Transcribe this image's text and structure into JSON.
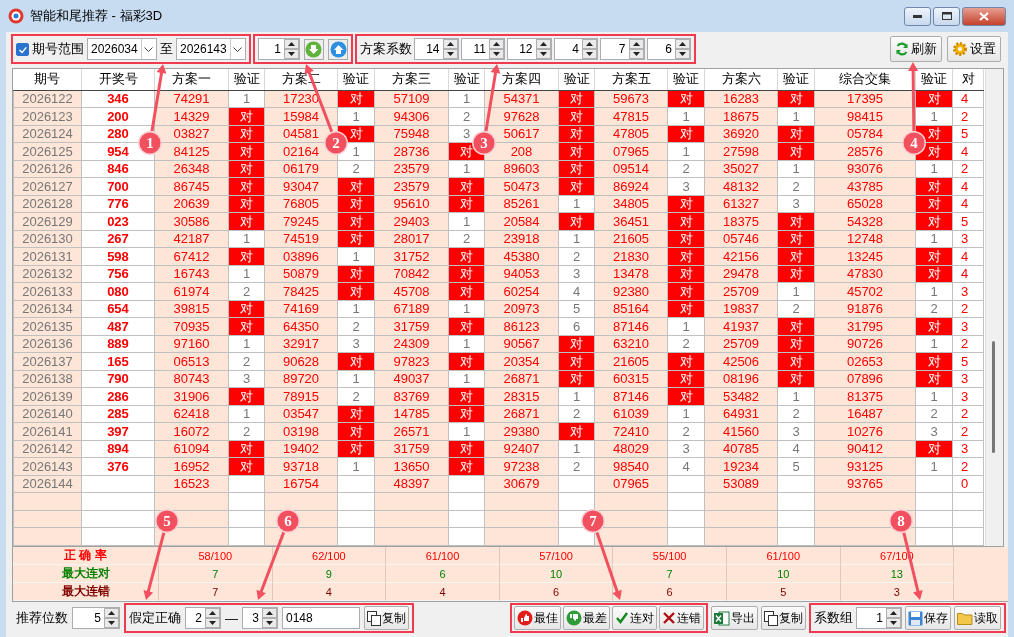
{
  "window": {
    "title": "智能和尾推荐 - 福彩3D"
  },
  "toolbar": {
    "range": {
      "checked": true,
      "label": "期号范围"
    },
    "from": "2026034",
    "to_label": "至",
    "to": "2026143",
    "step": "1",
    "coef_label": "方案系数",
    "coefs": [
      "14",
      "11",
      "12",
      "4",
      "7",
      "6"
    ],
    "buttons": [
      {
        "label": "刷新",
        "kind": "refresh"
      },
      {
        "label": "设置",
        "kind": "settings"
      }
    ]
  },
  "table": {
    "columns": [
      "期号",
      "开奖号",
      "方案一",
      "验证",
      "方案二",
      "验证",
      "方案三",
      "验证",
      "方案四",
      "验证",
      "方案五",
      "验证",
      "方案六",
      "验证",
      "综合交集",
      "验证",
      "对"
    ],
    "rows": [
      {
        "period": "2026122",
        "draw": "346",
        "plans": [
          {
            "value": "74291",
            "check": "1",
            "hit": false
          },
          {
            "value": "17230",
            "check": "对",
            "hit": true
          },
          {
            "value": "57109",
            "check": "1",
            "hit": false
          },
          {
            "value": "54371",
            "check": "对",
            "hit": true
          },
          {
            "value": "59673",
            "check": "对",
            "hit": true
          },
          {
            "value": "16283",
            "check": "对",
            "hit": true
          },
          {
            "value": "17395",
            "check": "对",
            "hit": true
          }
        ],
        "total": "4"
      },
      {
        "period": "2026123",
        "draw": "200",
        "plans": [
          {
            "value": "14329",
            "check": "对",
            "hit": true
          },
          {
            "value": "15984",
            "check": "1",
            "hit": false
          },
          {
            "value": "94306",
            "check": "2",
            "hit": false
          },
          {
            "value": "97628",
            "check": "对",
            "hit": true
          },
          {
            "value": "47815",
            "check": "1",
            "hit": false
          },
          {
            "value": "18675",
            "check": "1",
            "hit": false
          },
          {
            "value": "98415",
            "check": "1",
            "hit": false
          }
        ],
        "total": "2"
      },
      {
        "period": "2026124",
        "draw": "280",
        "plans": [
          {
            "value": "03827",
            "check": "对",
            "hit": true
          },
          {
            "value": "04581",
            "check": "对",
            "hit": true
          },
          {
            "value": "75948",
            "check": "3",
            "hit": false
          },
          {
            "value": "50617",
            "check": "对",
            "hit": true
          },
          {
            "value": "47805",
            "check": "对",
            "hit": true
          },
          {
            "value": "36920",
            "check": "对",
            "hit": true
          },
          {
            "value": "05784",
            "check": "对",
            "hit": true
          }
        ],
        "total": "5"
      },
      {
        "period": "2026125",
        "draw": "954",
        "plans": [
          {
            "value": "84125",
            "check": "对",
            "hit": true
          },
          {
            "value": "02164",
            "check": "1",
            "hit": false
          },
          {
            "value": "28736",
            "check": "对",
            "hit": true
          },
          {
            "value": "208",
            "check": "对",
            "hit": true
          },
          {
            "value": "07965",
            "check": "1",
            "hit": false
          },
          {
            "value": "27598",
            "check": "对",
            "hit": true
          },
          {
            "value": "28576",
            "check": "对",
            "hit": true
          }
        ],
        "total": "4"
      },
      {
        "period": "2026126",
        "draw": "846",
        "plans": [
          {
            "value": "26348",
            "check": "对",
            "hit": true
          },
          {
            "value": "06179",
            "check": "2",
            "hit": false
          },
          {
            "value": "23579",
            "check": "1",
            "hit": false
          },
          {
            "value": "89603",
            "check": "对",
            "hit": true
          },
          {
            "value": "09514",
            "check": "2",
            "hit": false
          },
          {
            "value": "35027",
            "check": "1",
            "hit": false
          },
          {
            "value": "93076",
            "check": "1",
            "hit": false
          }
        ],
        "total": "2"
      },
      {
        "period": "2026127",
        "draw": "700",
        "plans": [
          {
            "value": "86745",
            "check": "对",
            "hit": true
          },
          {
            "value": "93047",
            "check": "对",
            "hit": true
          },
          {
            "value": "23579",
            "check": "对",
            "hit": true
          },
          {
            "value": "50473",
            "check": "对",
            "hit": true
          },
          {
            "value": "86924",
            "check": "3",
            "hit": false
          },
          {
            "value": "48132",
            "check": "2",
            "hit": false
          },
          {
            "value": "43785",
            "check": "对",
            "hit": true
          }
        ],
        "total": "4"
      },
      {
        "period": "2026128",
        "draw": "776",
        "plans": [
          {
            "value": "20639",
            "check": "对",
            "hit": true
          },
          {
            "value": "76805",
            "check": "对",
            "hit": true
          },
          {
            "value": "95610",
            "check": "对",
            "hit": true
          },
          {
            "value": "85261",
            "check": "1",
            "hit": false
          },
          {
            "value": "34805",
            "check": "对",
            "hit": true
          },
          {
            "value": "61327",
            "check": "3",
            "hit": false
          },
          {
            "value": "65028",
            "check": "对",
            "hit": true
          }
        ],
        "total": "4"
      },
      {
        "period": "2026129",
        "draw": "023",
        "plans": [
          {
            "value": "30586",
            "check": "对",
            "hit": true
          },
          {
            "value": "79245",
            "check": "对",
            "hit": true
          },
          {
            "value": "29403",
            "check": "1",
            "hit": false
          },
          {
            "value": "20584",
            "check": "对",
            "hit": true
          },
          {
            "value": "36451",
            "check": "对",
            "hit": true
          },
          {
            "value": "18375",
            "check": "对",
            "hit": true
          },
          {
            "value": "54328",
            "check": "对",
            "hit": true
          }
        ],
        "total": "5"
      },
      {
        "period": "2026130",
        "draw": "267",
        "plans": [
          {
            "value": "42187",
            "check": "1",
            "hit": false
          },
          {
            "value": "74519",
            "check": "对",
            "hit": true
          },
          {
            "value": "28017",
            "check": "2",
            "hit": false
          },
          {
            "value": "23918",
            "check": "1",
            "hit": false
          },
          {
            "value": "21605",
            "check": "对",
            "hit": true
          },
          {
            "value": "05746",
            "check": "对",
            "hit": true
          },
          {
            "value": "12748",
            "check": "1",
            "hit": false
          }
        ],
        "total": "3"
      },
      {
        "period": "2026131",
        "draw": "598",
        "plans": [
          {
            "value": "67412",
            "check": "对",
            "hit": true
          },
          {
            "value": "03896",
            "check": "1",
            "hit": false
          },
          {
            "value": "31752",
            "check": "对",
            "hit": true
          },
          {
            "value": "45380",
            "check": "2",
            "hit": false
          },
          {
            "value": "21830",
            "check": "对",
            "hit": true
          },
          {
            "value": "42156",
            "check": "对",
            "hit": true
          },
          {
            "value": "13245",
            "check": "对",
            "hit": true
          }
        ],
        "total": "4"
      },
      {
        "period": "2026132",
        "draw": "756",
        "plans": [
          {
            "value": "16743",
            "check": "1",
            "hit": false
          },
          {
            "value": "50879",
            "check": "对",
            "hit": true
          },
          {
            "value": "70842",
            "check": "对",
            "hit": true
          },
          {
            "value": "94053",
            "check": "3",
            "hit": false
          },
          {
            "value": "13478",
            "check": "对",
            "hit": true
          },
          {
            "value": "29478",
            "check": "对",
            "hit": true
          },
          {
            "value": "47830",
            "check": "对",
            "hit": true
          }
        ],
        "total": "4"
      },
      {
        "period": "2026133",
        "draw": "080",
        "plans": [
          {
            "value": "61974",
            "check": "2",
            "hit": false
          },
          {
            "value": "78425",
            "check": "对",
            "hit": true
          },
          {
            "value": "45708",
            "check": "对",
            "hit": true
          },
          {
            "value": "60254",
            "check": "4",
            "hit": false
          },
          {
            "value": "92380",
            "check": "对",
            "hit": true
          },
          {
            "value": "25709",
            "check": "1",
            "hit": false
          },
          {
            "value": "45702",
            "check": "1",
            "hit": false
          }
        ],
        "total": "3"
      },
      {
        "period": "2026134",
        "draw": "654",
        "plans": [
          {
            "value": "39815",
            "check": "对",
            "hit": true
          },
          {
            "value": "74169",
            "check": "1",
            "hit": false
          },
          {
            "value": "67189",
            "check": "1",
            "hit": false
          },
          {
            "value": "20973",
            "check": "5",
            "hit": false
          },
          {
            "value": "85164",
            "check": "对",
            "hit": true
          },
          {
            "value": "19837",
            "check": "2",
            "hit": false
          },
          {
            "value": "91876",
            "check": "2",
            "hit": false
          }
        ],
        "total": "2"
      },
      {
        "period": "2026135",
        "draw": "487",
        "plans": [
          {
            "value": "70935",
            "check": "对",
            "hit": true
          },
          {
            "value": "64350",
            "check": "2",
            "hit": false
          },
          {
            "value": "31759",
            "check": "对",
            "hit": true
          },
          {
            "value": "86123",
            "check": "6",
            "hit": false
          },
          {
            "value": "87146",
            "check": "1",
            "hit": false
          },
          {
            "value": "41937",
            "check": "对",
            "hit": true
          },
          {
            "value": "31795",
            "check": "对",
            "hit": true
          }
        ],
        "total": "3"
      },
      {
        "period": "2026136",
        "draw": "889",
        "plans": [
          {
            "value": "97160",
            "check": "1",
            "hit": false
          },
          {
            "value": "32917",
            "check": "3",
            "hit": false
          },
          {
            "value": "24309",
            "check": "1",
            "hit": false
          },
          {
            "value": "90567",
            "check": "对",
            "hit": true
          },
          {
            "value": "63210",
            "check": "2",
            "hit": false
          },
          {
            "value": "25709",
            "check": "对",
            "hit": true
          },
          {
            "value": "90726",
            "check": "1",
            "hit": false
          }
        ],
        "total": "2"
      },
      {
        "period": "2026137",
        "draw": "165",
        "plans": [
          {
            "value": "06513",
            "check": "2",
            "hit": false
          },
          {
            "value": "90628",
            "check": "对",
            "hit": true
          },
          {
            "value": "97823",
            "check": "对",
            "hit": true
          },
          {
            "value": "20354",
            "check": "对",
            "hit": true
          },
          {
            "value": "21605",
            "check": "对",
            "hit": true
          },
          {
            "value": "42506",
            "check": "对",
            "hit": true
          },
          {
            "value": "02653",
            "check": "对",
            "hit": true
          }
        ],
        "total": "5"
      },
      {
        "period": "2026138",
        "draw": "790",
        "plans": [
          {
            "value": "80743",
            "check": "3",
            "hit": false
          },
          {
            "value": "89720",
            "check": "1",
            "hit": false
          },
          {
            "value": "49037",
            "check": "1",
            "hit": false
          },
          {
            "value": "26871",
            "check": "对",
            "hit": true
          },
          {
            "value": "60315",
            "check": "对",
            "hit": true
          },
          {
            "value": "08196",
            "check": "对",
            "hit": true
          },
          {
            "value": "07896",
            "check": "对",
            "hit": true
          }
        ],
        "total": "3"
      },
      {
        "period": "2026139",
        "draw": "286",
        "plans": [
          {
            "value": "31906",
            "check": "对",
            "hit": true
          },
          {
            "value": "78915",
            "check": "2",
            "hit": false
          },
          {
            "value": "83769",
            "check": "对",
            "hit": true
          },
          {
            "value": "28315",
            "check": "1",
            "hit": false
          },
          {
            "value": "87146",
            "check": "对",
            "hit": true
          },
          {
            "value": "53482",
            "check": "1",
            "hit": false
          },
          {
            "value": "81375",
            "check": "1",
            "hit": false
          }
        ],
        "total": "3"
      },
      {
        "period": "2026140",
        "draw": "285",
        "plans": [
          {
            "value": "62418",
            "check": "1",
            "hit": false
          },
          {
            "value": "03547",
            "check": "对",
            "hit": true
          },
          {
            "value": "14785",
            "check": "对",
            "hit": true
          },
          {
            "value": "26871",
            "check": "2",
            "hit": false
          },
          {
            "value": "61039",
            "check": "1",
            "hit": false
          },
          {
            "value": "64931",
            "check": "2",
            "hit": false
          },
          {
            "value": "16487",
            "check": "2",
            "hit": false
          }
        ],
        "total": "2"
      },
      {
        "period": "2026141",
        "draw": "397",
        "plans": [
          {
            "value": "16072",
            "check": "2",
            "hit": false
          },
          {
            "value": "03198",
            "check": "对",
            "hit": true
          },
          {
            "value": "26571",
            "check": "1",
            "hit": false
          },
          {
            "value": "29380",
            "check": "对",
            "hit": true
          },
          {
            "value": "72410",
            "check": "2",
            "hit": false
          },
          {
            "value": "41560",
            "check": "3",
            "hit": false
          },
          {
            "value": "10276",
            "check": "3",
            "hit": false
          }
        ],
        "total": "2"
      },
      {
        "period": "2026142",
        "draw": "894",
        "plans": [
          {
            "value": "61094",
            "check": "对",
            "hit": true
          },
          {
            "value": "19402",
            "check": "对",
            "hit": true
          },
          {
            "value": "31759",
            "check": "对",
            "hit": true
          },
          {
            "value": "92407",
            "check": "1",
            "hit": false
          },
          {
            "value": "48029",
            "check": "3",
            "hit": false
          },
          {
            "value": "40785",
            "check": "4",
            "hit": false
          },
          {
            "value": "90412",
            "check": "对",
            "hit": true
          }
        ],
        "total": "3"
      },
      {
        "period": "2026143",
        "draw": "376",
        "plans": [
          {
            "value": "16952",
            "check": "对",
            "hit": true
          },
          {
            "value": "93718",
            "check": "1",
            "hit": false
          },
          {
            "value": "13650",
            "check": "对",
            "hit": true
          },
          {
            "value": "97238",
            "check": "2",
            "hit": false
          },
          {
            "value": "98540",
            "check": "4",
            "hit": false
          },
          {
            "value": "19234",
            "check": "5",
            "hit": false
          },
          {
            "value": "93125",
            "check": "1",
            "hit": false
          }
        ],
        "total": "2"
      },
      {
        "period": "2026144",
        "plans": [
          {
            "value": "16523"
          },
          {
            "value": "16754"
          },
          {
            "value": "48397"
          },
          {
            "value": "30679"
          },
          {
            "value": "07965"
          },
          {
            "value": "53089"
          },
          {
            "value": "93765"
          }
        ],
        "total": "0"
      }
    ]
  },
  "summary": [
    {
      "label": "正 确 率",
      "color": "#ff0000",
      "values": [
        "58/100",
        "62/100",
        "61/100",
        "57/100",
        "55/100",
        "61/100",
        "67/100"
      ]
    },
    {
      "label": "最大连对",
      "color": "#008000",
      "values": [
        "7",
        "9",
        "6",
        "10",
        "7",
        "10",
        "13"
      ]
    },
    {
      "label": "最大连错",
      "color": "#800000",
      "values": [
        "7",
        "4",
        "4",
        "6",
        "6",
        "5",
        "3"
      ]
    }
  ],
  "bottom": {
    "digits_label": "推荐位数",
    "digits": "5",
    "assume_label": "假定正确",
    "assume_from": "2",
    "dash": "—",
    "assume_to": "3",
    "numbers": "0148",
    "copy": "复制",
    "actions": [
      {
        "label": "最佳",
        "kind": "best"
      },
      {
        "label": "最差",
        "kind": "worst"
      },
      {
        "label": "连对",
        "kind": "streak-hit"
      },
      {
        "label": "连错",
        "kind": "streak-miss"
      }
    ],
    "export": "导出",
    "copy2": "复制",
    "group_label": "系数组",
    "group": "1",
    "save": "保存",
    "load": "读取"
  },
  "callouts": [
    {
      "label": "1"
    },
    {
      "label": "2"
    },
    {
      "label": "3"
    },
    {
      "label": "4"
    },
    {
      "label": "5"
    },
    {
      "label": "6"
    },
    {
      "label": "7"
    },
    {
      "label": "8"
    }
  ]
}
